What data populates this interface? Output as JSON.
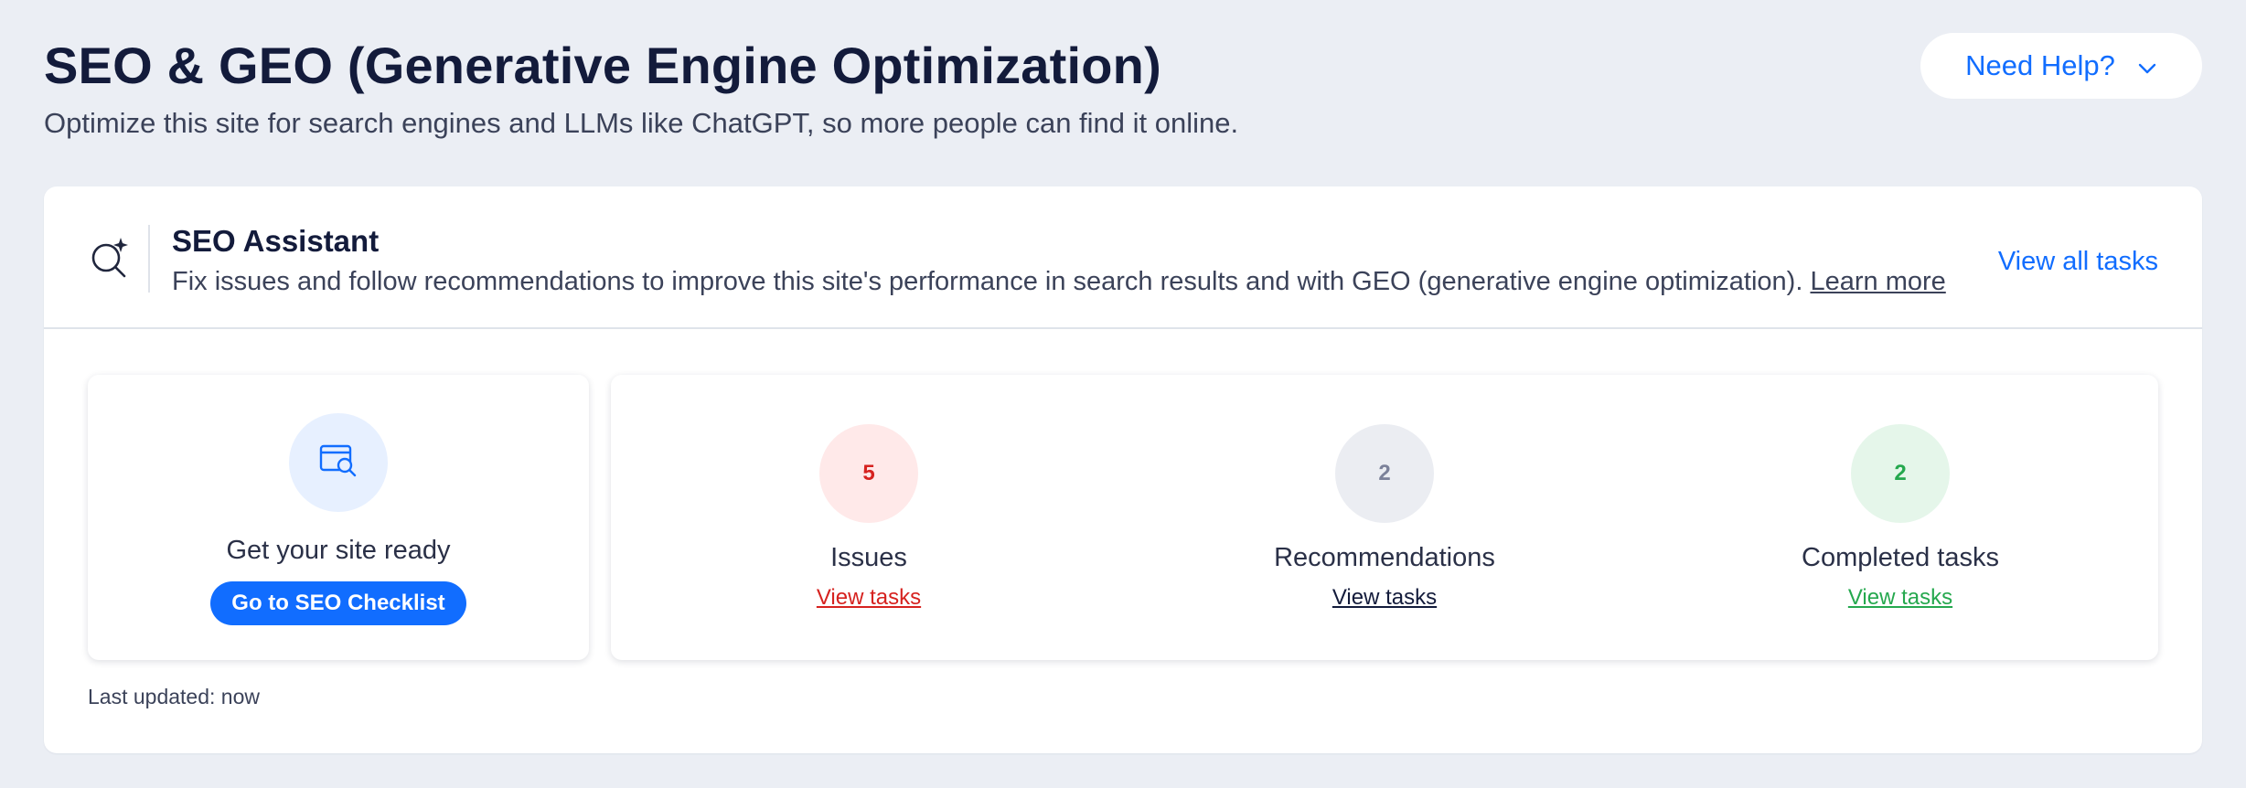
{
  "header": {
    "title": "SEO & GEO (Generative Engine Optimization)",
    "subtitle": "Optimize this site for search engines and LLMs like ChatGPT, so more people can find it online.",
    "help_label": "Need Help?"
  },
  "assistant": {
    "title": "SEO Assistant",
    "description": "Fix issues and follow recommendations to improve this site's performance in search results and with GEO (generative engine optimization).",
    "learn_more": "Learn more",
    "view_all": "View all tasks"
  },
  "checklist": {
    "text": "Get your site ready",
    "button": "Go to SEO Checklist"
  },
  "stats": [
    {
      "count": "5",
      "label": "Issues",
      "link": "View tasks",
      "color": "#d6221f",
      "bg": "#ffe9e9",
      "link_color": "#d6221f"
    },
    {
      "count": "2",
      "label": "Recommendations",
      "link": "View tasks",
      "color": "#7b8199",
      "bg": "#ebedf2",
      "link_color": "#131b3b"
    },
    {
      "count": "2",
      "label": "Completed tasks",
      "link": "View tasks",
      "color": "#25a84e",
      "bg": "#e5f6ea",
      "link_color": "#25a84e"
    }
  ],
  "footer": {
    "last_updated": "Last updated: now"
  },
  "icons": {
    "assistant": "search-sparkle-icon",
    "checklist": "browser-search-icon",
    "help_chevron": "chevron-down-icon"
  },
  "colors": {
    "accent": "#116dff",
    "background": "#ebeef4"
  }
}
